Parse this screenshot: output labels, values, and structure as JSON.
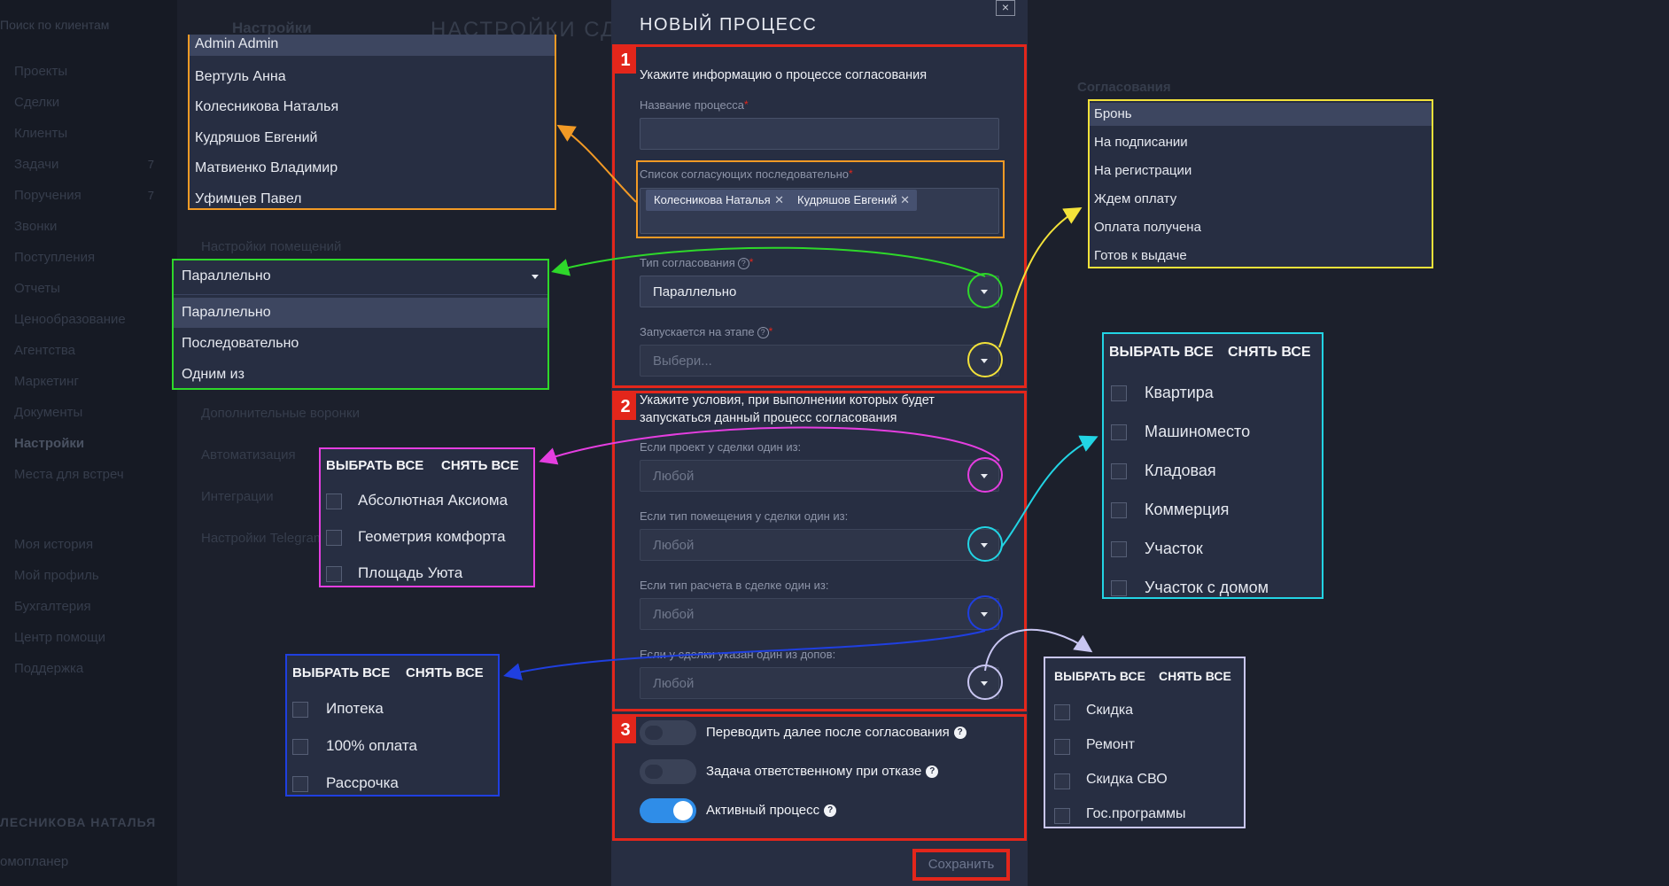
{
  "background": {
    "sidebar_search": "Поиск по клиентам",
    "sidebar_items": [
      {
        "label": "Проекты",
        "count": ""
      },
      {
        "label": "Сделки",
        "count": ""
      },
      {
        "label": "Клиенты",
        "count": ""
      },
      {
        "label": "Задачи",
        "count": "7"
      },
      {
        "label": "Поручения",
        "count": "7"
      },
      {
        "label": "Звонки",
        "count": ""
      },
      {
        "label": "Поступления",
        "count": ""
      },
      {
        "label": "Отчеты",
        "count": ""
      },
      {
        "label": "Ценообразование",
        "count": ""
      },
      {
        "label": "Агентства",
        "count": ""
      },
      {
        "label": "Маркетинг",
        "count": ""
      },
      {
        "label": "Документы",
        "count": ""
      },
      {
        "label": "Настройки",
        "count": ""
      },
      {
        "label": "Места для встреч",
        "count": ""
      },
      {
        "label": "Моя история",
        "count": ""
      },
      {
        "label": "Мой профиль",
        "count": ""
      },
      {
        "label": "Бухгалтерия",
        "count": ""
      },
      {
        "label": "Центр помощи",
        "count": ""
      },
      {
        "label": "Поддержка",
        "count": ""
      }
    ],
    "user_name": "ЛЕСНИКОВА НАТАЛЬЯ",
    "app_label": "омопланер",
    "settings_title": "Настройки",
    "page_title": "НАСТРОЙКИ СД",
    "settings_menu": [
      "Настройки помещений",
      "Дополнительные воронки",
      "Автоматизация",
      "Интеграции",
      "Настройки Telegram"
    ],
    "tab_label": "Согласования"
  },
  "modal": {
    "title": "НОВЫЙ ПРОЦЕСС",
    "close": "×",
    "section1": {
      "num": "1",
      "heading": "Укажите информацию о процессе согласования",
      "name_label": "Название процесса",
      "approvers_label": "Список согласующих последовательно",
      "approvers": [
        "Колесникова Наталья",
        "Кудряшов Евгений"
      ],
      "type_label": "Тип согласования",
      "type_value": "Параллельно",
      "stage_label": "Запускается на этапе",
      "stage_placeholder": "Выбери..."
    },
    "section2": {
      "num": "2",
      "heading": "Укажите условия, при выполнении которых будет запускаться данный процесс согласования",
      "fields": [
        {
          "label": "Если проект у сделки один из:",
          "value": "Любой"
        },
        {
          "label": "Если тип помещения у сделки один из:",
          "value": "Любой"
        },
        {
          "label": "Если тип расчета в сделке один из:",
          "value": "Любой"
        },
        {
          "label": "Если у сделки указан один из допов:",
          "value": "Любой"
        }
      ]
    },
    "section3": {
      "num": "3",
      "toggles": [
        {
          "label": "Переводить далее после согласования",
          "on": false
        },
        {
          "label": "Задача ответственному при отказе",
          "on": false
        },
        {
          "label": "Активный процесс",
          "on": true
        }
      ]
    },
    "save": "Сохранить"
  },
  "popups": {
    "users": [
      "Admin Admin",
      "Вертуль Анна",
      "Колесникова Наталья",
      "Кудряшов Евгений",
      "Матвиенко Владимир",
      "Уфимцев Павел"
    ],
    "approval_type": {
      "selected": "Параллельно",
      "options": [
        "Параллельно",
        "Последовательно",
        "Одним из"
      ]
    },
    "stages": [
      "Бронь",
      "На подписании",
      "На регистрации",
      "Ждем оплату",
      "Оплата получена",
      "Готов к выдаче"
    ],
    "select_all": "ВЫБРАТЬ ВСЕ",
    "clear_all": "СНЯТЬ ВСЕ",
    "projects": [
      "Абсолютная Аксиома",
      "Геометрия комфорта",
      "Площадь Уюта"
    ],
    "room_types": [
      "Квартира",
      "Машиноместо",
      "Кладовая",
      "Коммерция",
      "Участок",
      "Участок с домом"
    ],
    "payment_types": [
      "Ипотека",
      "100% оплата",
      "Рассрочка"
    ],
    "extras": [
      "Скидка",
      "Ремонт",
      "Скидка СВО",
      "Гос.программы"
    ]
  },
  "colors": {
    "red": "#e3261b",
    "orange": "#f29a25",
    "green": "#2ed82a",
    "yellow": "#f3e23a",
    "magenta": "#e53ee0",
    "cyan": "#22d4e4",
    "blue": "#1f3fe0",
    "lavender": "#c9c6f2",
    "toggle_on": "#2f8de8"
  }
}
